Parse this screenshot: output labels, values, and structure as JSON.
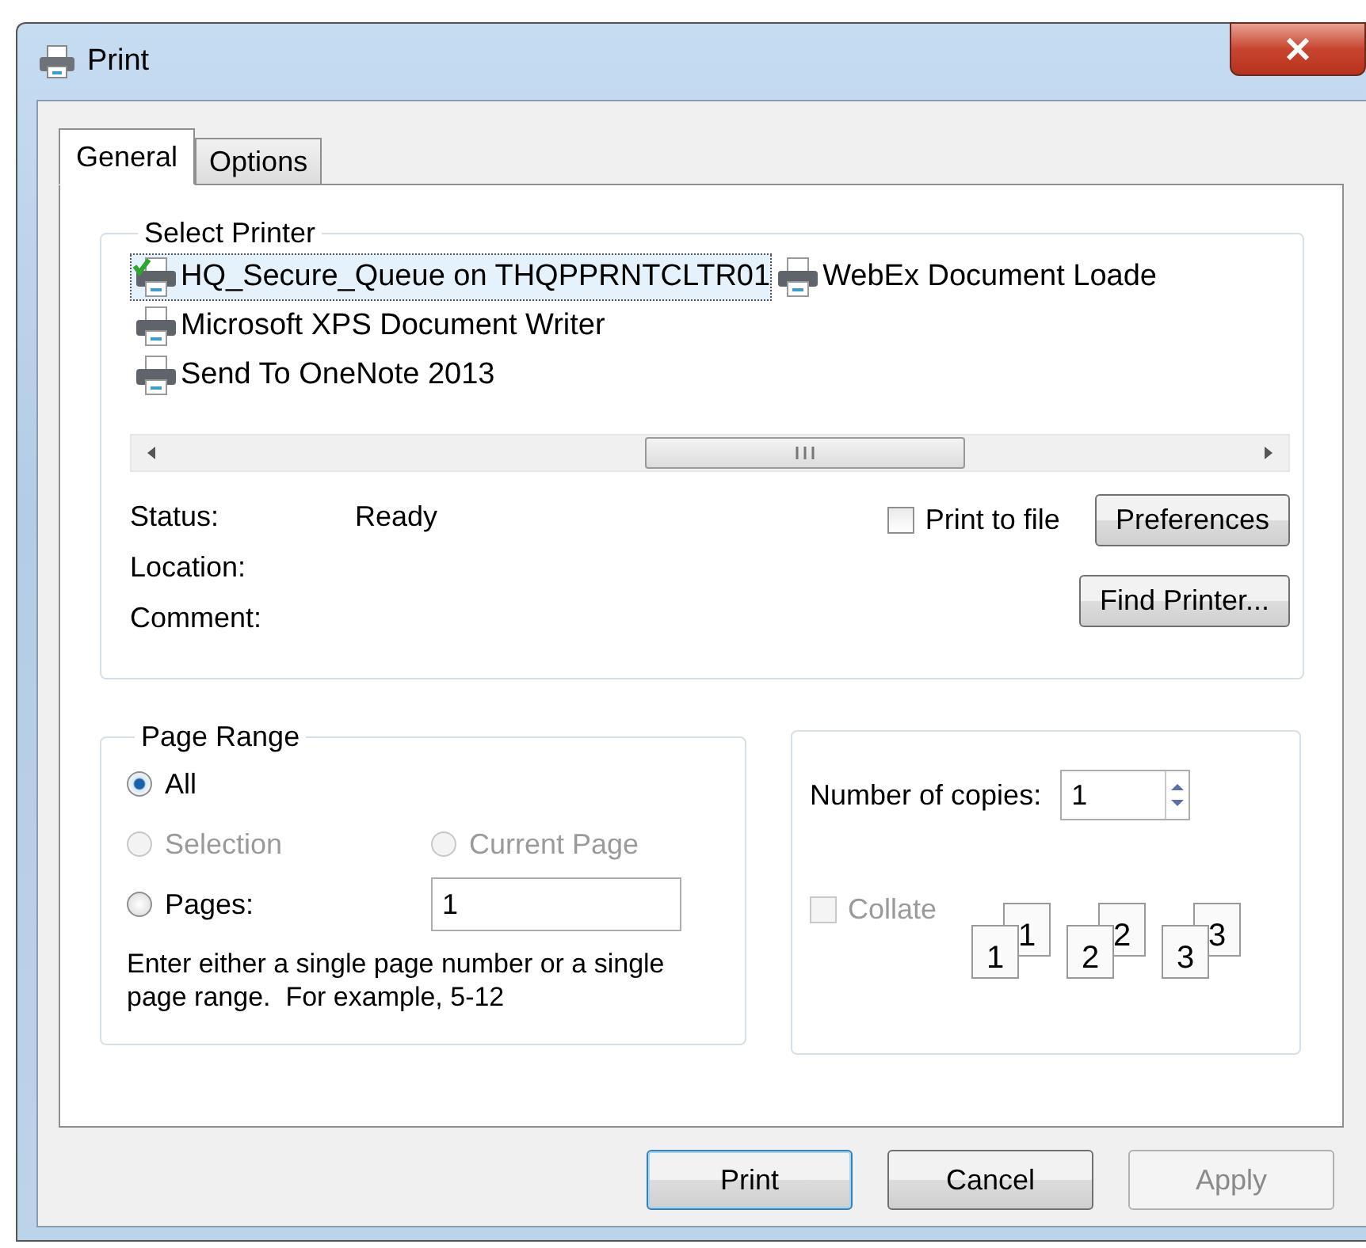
{
  "window": {
    "title": "Print"
  },
  "tabs": [
    {
      "label": "General",
      "selected": true
    },
    {
      "label": "Options",
      "selected": false
    }
  ],
  "select_printer": {
    "title": "Select Printer",
    "printers": [
      {
        "name": "HQ_Secure_Queue on THQPPRNTCLTR01",
        "selected": true,
        "default": true
      },
      {
        "name": "Microsoft XPS Document Writer",
        "selected": false,
        "default": false
      },
      {
        "name": "Send To OneNote 2013",
        "selected": false,
        "default": false
      },
      {
        "name": "WebEx Document Loade",
        "selected": false,
        "default": false
      }
    ],
    "status_label": "Status:",
    "status_value": "Ready",
    "location_label": "Location:",
    "comment_label": "Comment:",
    "print_to_file": {
      "label": "Print to file",
      "checked": false
    },
    "preferences_button": "Preferences",
    "find_printer_button": "Find Printer..."
  },
  "page_range": {
    "title": "Page Range",
    "options": [
      {
        "label": "All",
        "selected": true,
        "disabled": false
      },
      {
        "label": "Selection",
        "selected": false,
        "disabled": true
      },
      {
        "label": "Current Page",
        "selected": false,
        "disabled": true
      },
      {
        "label": "Pages:",
        "selected": false,
        "disabled": false
      }
    ],
    "pages_value": "1",
    "hint": "Enter either a single page number or a single page range.  For example, 5-12"
  },
  "copies": {
    "label": "Number of copies:",
    "value": "1",
    "collate": {
      "label": "Collate",
      "checked": false,
      "disabled": true
    },
    "collate_pages": [
      {
        "back": "1",
        "front": "1"
      },
      {
        "back": "2",
        "front": "2"
      },
      {
        "back": "3",
        "front": "3"
      }
    ]
  },
  "buttons": [
    {
      "label": "Print",
      "disabled": false,
      "default": true
    },
    {
      "label": "Cancel",
      "disabled": false,
      "default": false
    },
    {
      "label": "Apply",
      "disabled": true,
      "default": false
    }
  ]
}
